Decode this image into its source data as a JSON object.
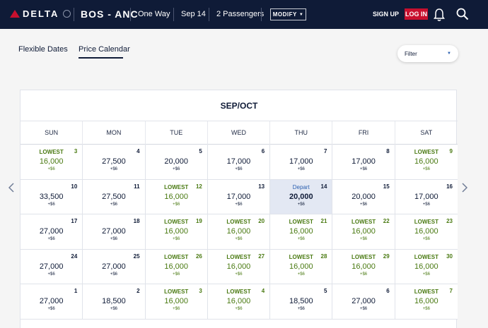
{
  "header": {
    "logo_text": "DELTA",
    "route": "BOS - ANC",
    "trip_type": "One Way",
    "date": "Sep 14",
    "passengers": "2 Passengers",
    "modify_label": "MODIFY",
    "signup_label": "SIGN UP",
    "login_label": "LOG IN"
  },
  "tabs": [
    {
      "label": "Flexible Dates"
    },
    {
      "label": "Price Calendar",
      "active": true
    }
  ],
  "filter": {
    "label": "Filter"
  },
  "calendar": {
    "month_label": "SEP/OCT",
    "weekdays": [
      "SUN",
      "MON",
      "TUE",
      "WED",
      "THU",
      "FRI",
      "SAT"
    ],
    "days": [
      {
        "day": "3",
        "label": "LOWEST",
        "price": "16,000",
        "fee": "+$6",
        "lowest": true
      },
      {
        "day": "4",
        "label": "",
        "price": "27,500",
        "fee": "+$6"
      },
      {
        "day": "5",
        "label": "",
        "price": "20,000",
        "fee": "+$6"
      },
      {
        "day": "6",
        "label": "",
        "price": "17,000",
        "fee": "+$6"
      },
      {
        "day": "7",
        "label": "",
        "price": "17,000",
        "fee": "+$6"
      },
      {
        "day": "8",
        "label": "",
        "price": "17,000",
        "fee": "+$6"
      },
      {
        "day": "9",
        "label": "LOWEST",
        "price": "16,000",
        "fee": "+$6",
        "lowest": true
      },
      {
        "day": "10",
        "label": "",
        "price": "33,500",
        "fee": "+$6"
      },
      {
        "day": "11",
        "label": "",
        "price": "27,500",
        "fee": "+$6"
      },
      {
        "day": "12",
        "label": "LOWEST",
        "price": "16,000",
        "fee": "+$6",
        "lowest": true
      },
      {
        "day": "13",
        "label": "",
        "price": "17,000",
        "fee": "+$6"
      },
      {
        "day": "14",
        "label": "Depart",
        "price": "20,000",
        "fee": "+$6",
        "selected": true
      },
      {
        "day": "15",
        "label": "",
        "price": "20,000",
        "fee": "+$6"
      },
      {
        "day": "16",
        "label": "",
        "price": "17,000",
        "fee": "+$6"
      },
      {
        "day": "17",
        "label": "",
        "price": "27,000",
        "fee": "+$6"
      },
      {
        "day": "18",
        "label": "",
        "price": "27,000",
        "fee": "+$6"
      },
      {
        "day": "19",
        "label": "LOWEST",
        "price": "16,000",
        "fee": "+$6",
        "lowest": true
      },
      {
        "day": "20",
        "label": "LOWEST",
        "price": "16,000",
        "fee": "+$6",
        "lowest": true
      },
      {
        "day": "21",
        "label": "LOWEST",
        "price": "16,000",
        "fee": "+$6",
        "lowest": true
      },
      {
        "day": "22",
        "label": "LOWEST",
        "price": "16,000",
        "fee": "+$6",
        "lowest": true
      },
      {
        "day": "23",
        "label": "LOWEST",
        "price": "16,000",
        "fee": "+$6",
        "lowest": true
      },
      {
        "day": "24",
        "label": "",
        "price": "27,000",
        "fee": "+$6"
      },
      {
        "day": "25",
        "label": "",
        "price": "27,000",
        "fee": "+$6"
      },
      {
        "day": "26",
        "label": "LOWEST",
        "price": "16,000",
        "fee": "+$6",
        "lowest": true
      },
      {
        "day": "27",
        "label": "LOWEST",
        "price": "16,000",
        "fee": "+$6",
        "lowest": true
      },
      {
        "day": "28",
        "label": "LOWEST",
        "price": "16,000",
        "fee": "+$6",
        "lowest": true
      },
      {
        "day": "29",
        "label": "LOWEST",
        "price": "16,000",
        "fee": "+$6",
        "lowest": true
      },
      {
        "day": "30",
        "label": "LOWEST",
        "price": "16,000",
        "fee": "+$6",
        "lowest": true
      },
      {
        "day": "1",
        "label": "",
        "price": "27,000",
        "fee": "+$6"
      },
      {
        "day": "2",
        "label": "",
        "price": "18,500",
        "fee": "+$6"
      },
      {
        "day": "3",
        "label": "LOWEST",
        "price": "16,000",
        "fee": "+$6",
        "lowest": true
      },
      {
        "day": "4",
        "label": "LOWEST",
        "price": "16,000",
        "fee": "+$6",
        "lowest": true
      },
      {
        "day": "5",
        "label": "",
        "price": "18,500",
        "fee": "+$6"
      },
      {
        "day": "6",
        "label": "",
        "price": "27,000",
        "fee": "+$6"
      },
      {
        "day": "7",
        "label": "LOWEST",
        "price": "16,000",
        "fee": "+$6",
        "lowest": true
      }
    ]
  },
  "colors": {
    "header_bg": "#0f1b37",
    "brand_red": "#c8102e",
    "lowest_green": "#4a7a12",
    "selected_bg": "#e3e8f3"
  },
  "icons": [
    "delta-logo-icon",
    "globe-icon",
    "chevron-down-icon",
    "bell-icon",
    "search-icon",
    "chevron-left-icon",
    "chevron-right-icon"
  ]
}
